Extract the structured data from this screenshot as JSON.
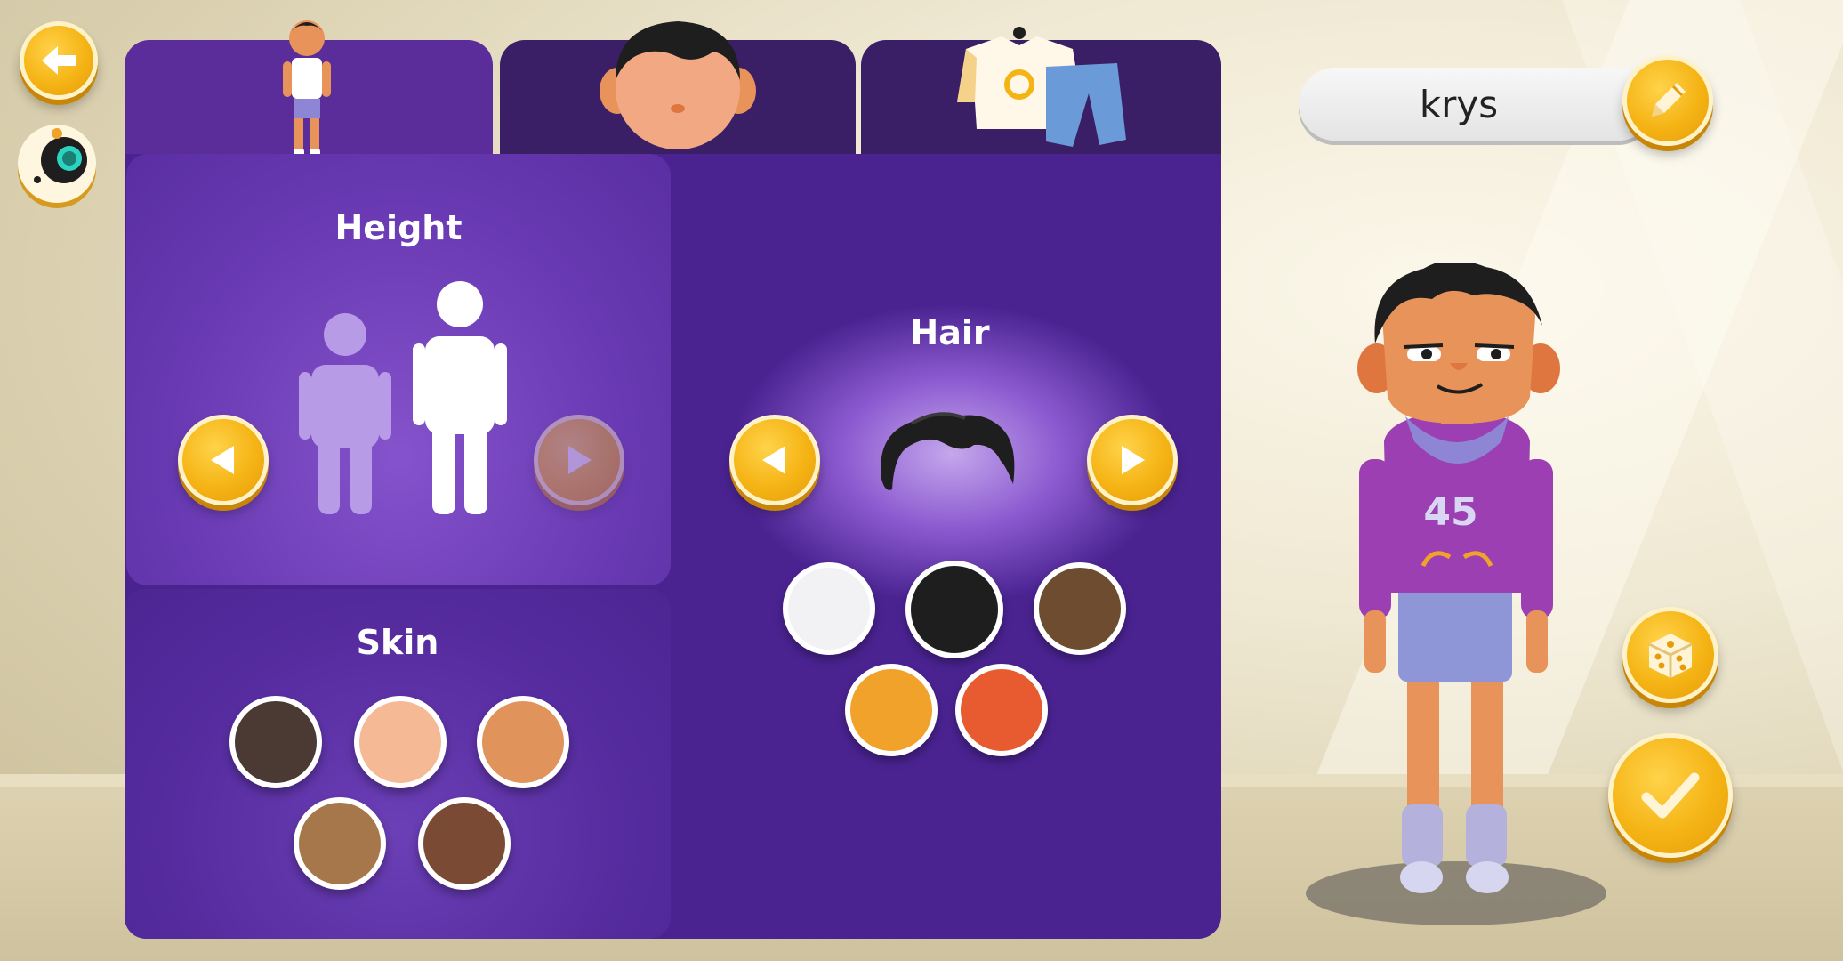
{
  "header": {
    "player_name": "krys"
  },
  "tabs": [
    {
      "id": "body",
      "icon": "body-icon",
      "active": true
    },
    {
      "id": "face",
      "icon": "face-icon",
      "active": false
    },
    {
      "id": "clothes",
      "icon": "clothes-icon",
      "active": false
    }
  ],
  "sections": {
    "height": {
      "label": "Height"
    },
    "hair": {
      "label": "Hair",
      "colors": [
        "#f2f2f4",
        "#1e1e1e",
        "#6e4c30",
        "#f0a22a",
        "#e85a30"
      ],
      "selected_color": "#1e1e1e"
    },
    "skin": {
      "label": "Skin",
      "colors": [
        "#4a3a33",
        "#f6b995",
        "#e0935a",
        "#a5774a",
        "#7a4a34"
      ]
    }
  },
  "avatar": {
    "shirt_number": "45",
    "shirt_color": "#8a3db0",
    "hood_color": "#8e86d4"
  },
  "colors": {
    "accent": "#f5b415",
    "panel": "#4a2391"
  }
}
